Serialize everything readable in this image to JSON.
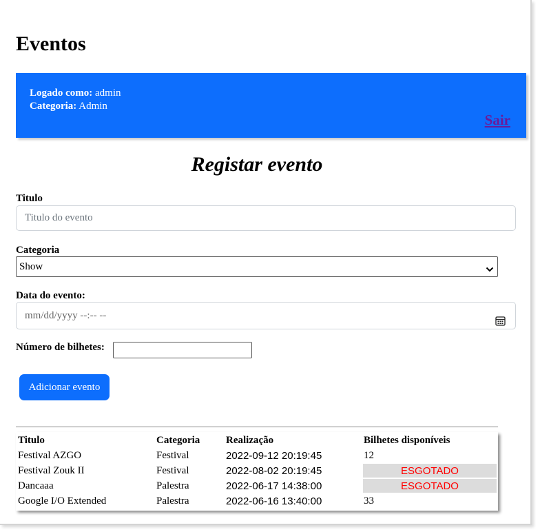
{
  "page": {
    "title": "Eventos"
  },
  "session": {
    "logged_label": "Logado como:",
    "username": "admin",
    "category_label": "Categoria:",
    "category": "Admin",
    "logout_label": "Sair"
  },
  "form": {
    "title": "Registar evento",
    "titulo_label": "Titulo",
    "titulo_placeholder": "Titulo do evento",
    "categoria_label": "Categoria",
    "categoria_selected": "Show",
    "data_label": "Data do evento:",
    "data_placeholder": "mm/dd/yyyy --:-- --",
    "bilhetes_label": "Número de bilhetes:",
    "bilhetes_value": "",
    "submit_label": "Adicionar evento"
  },
  "table": {
    "headers": [
      "Titulo",
      "Categoria",
      "Realização",
      "Bilhetes disponíveis"
    ],
    "rows": [
      {
        "titulo": "Festival AZGO",
        "categoria": "Festival",
        "realizacao": "2022-09-12 20:19:45",
        "bilhetes": "12",
        "esgotado": false
      },
      {
        "titulo": "Festival Zouk II",
        "categoria": "Festival",
        "realizacao": "2022-08-02 20:19:45",
        "bilhetes": "ESGOTADO",
        "esgotado": true
      },
      {
        "titulo": "Dancaaa",
        "categoria": "Palestra",
        "realizacao": "2022-06-17 14:38:00",
        "bilhetes": "ESGOTADO",
        "esgotado": true
      },
      {
        "titulo": "Google I/O Extended",
        "categoria": "Palestra",
        "realizacao": "2022-06-16 13:40:00",
        "bilhetes": "33",
        "esgotado": false
      }
    ]
  },
  "colors": {
    "accent": "#0d6efd",
    "soldout_text": "#ff0000",
    "soldout_bg": "#dcdcdc",
    "logout_link": "#6a1b9a"
  },
  "icons": {
    "select": "chevron-down-icon",
    "date": "calendar-icon"
  }
}
